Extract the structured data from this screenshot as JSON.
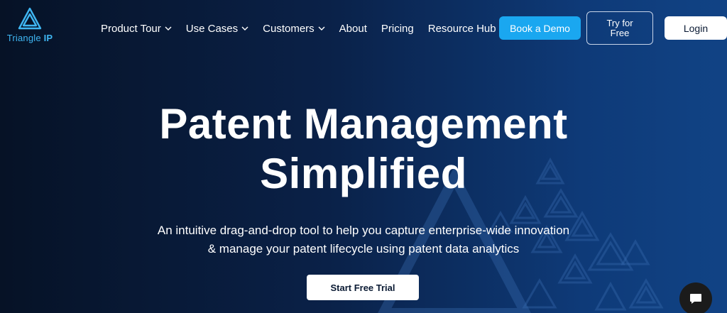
{
  "brand": {
    "name_light": "Triangle ",
    "name_bold": "IP",
    "accent": "#1aa7f0"
  },
  "nav": {
    "items": [
      {
        "label": "Product Tour",
        "dropdown": true
      },
      {
        "label": "Use Cases",
        "dropdown": true
      },
      {
        "label": "Customers",
        "dropdown": true
      },
      {
        "label": "About",
        "dropdown": false
      },
      {
        "label": "Pricing",
        "dropdown": false
      },
      {
        "label": "Resource Hub",
        "dropdown": true
      }
    ],
    "book_demo": "Book a Demo",
    "try_free": "Try for\nFree",
    "login": "Login"
  },
  "hero": {
    "title_line1": "Patent Management",
    "title_line2": "Simplified",
    "subtitle_line1": "An intuitive drag-and-drop tool to help you capture enterprise-wide innovation",
    "subtitle_line2": "& manage your patent lifecycle using patent data analytics",
    "cta": "Start Free Trial"
  },
  "icons": {
    "chat": "chat-icon",
    "logo": "triangle-logo-icon",
    "dropdown": "chevron-down-icon"
  }
}
